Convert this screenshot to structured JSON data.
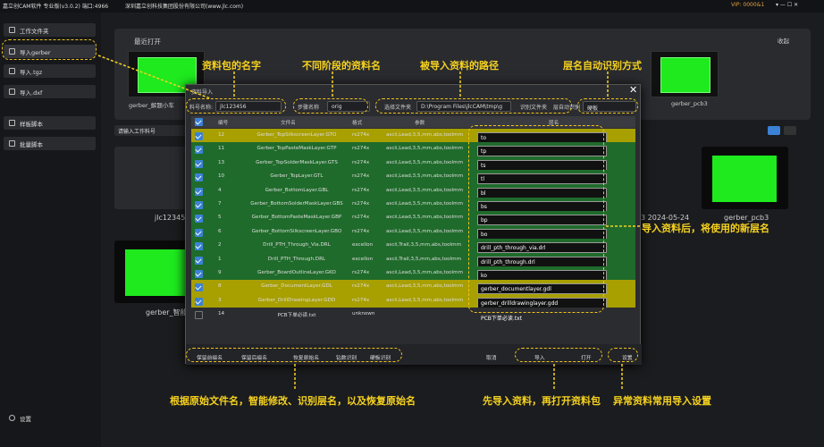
{
  "titlebar": {
    "app": "嘉立创CAM软件 专业版(v3.0.2) 端口:4966",
    "company": "深圳嘉立创科技集团股份有限公司(www.jlc.com)",
    "vip": "VIP: 0000&1",
    "controls": "▾  —  ☐  ✕"
  },
  "sidebar": {
    "items": [
      "工作文件夹",
      "导入gerber",
      "导入.tgz",
      "导入.dxf",
      "样板脚本",
      "批量脚本"
    ],
    "settings": "设置"
  },
  "recent": {
    "title": "最近打开",
    "collapse": "收起",
    "items": [
      "gerber_解题小车",
      "gerber_pcb3"
    ]
  },
  "workspace": {
    "search_placeholder": "请输入工作料号",
    "cards": [
      "jlc123456",
      "3  2024-05-24",
      "gerber_pcb3",
      "gerber_智能"
    ]
  },
  "dialog": {
    "title": "资料导入",
    "part_label": "料号名称:",
    "part_value": "jlc123456",
    "step_label": "步骤名称",
    "step_value": "orig",
    "folder_label": "选择文件夹",
    "folder_value": "D:\\Program Files\\jlcCAM\\tmp\\g",
    "folder_btn": "识别文件夹",
    "auto_label": "层自动识别",
    "auto_value": "硬板",
    "headers": [
      "编号",
      "文件名",
      "格式",
      "参数",
      "层名"
    ],
    "rows": [
      [
        "12",
        "Gerber_TopSilkscreenLayer.GTO",
        "rs274x",
        "ascii,Lead,3,5,mm,abs,toolmm",
        "to",
        true,
        "y"
      ],
      [
        "11",
        "Gerber_TopPasteMaskLayer.GTP",
        "rs274x",
        "ascii,Lead,3,5,mm,abs,toolmm",
        "tp",
        true,
        "g"
      ],
      [
        "13",
        "Gerber_TopSolderMaskLayer.GTS",
        "rs274x",
        "ascii,Lead,3,5,mm,abs,toolmm",
        "ts",
        true,
        "g"
      ],
      [
        "10",
        "Gerber_TopLayer.GTL",
        "rs274x",
        "ascii,Lead,3,5,mm,abs,toolmm",
        "tl",
        true,
        "g"
      ],
      [
        "4",
        "Gerber_BottomLayer.GBL",
        "rs274x",
        "ascii,Lead,3,5,mm,abs,toolmm",
        "bl",
        true,
        "g"
      ],
      [
        "7",
        "Gerber_BottomSolderMaskLayer.GBS",
        "rs274x",
        "ascii,Lead,3,5,mm,abs,toolmm",
        "bs",
        true,
        "g"
      ],
      [
        "5",
        "Gerber_BottomPasteMaskLayer.GBP",
        "rs274x",
        "ascii,Lead,3,5,mm,abs,toolmm",
        "bp",
        true,
        "g"
      ],
      [
        "6",
        "Gerber_BottomSilkscreenLayer.GBO",
        "rs274x",
        "ascii,Lead,3,5,mm,abs,toolmm",
        "bo",
        true,
        "g"
      ],
      [
        "2",
        "Drill_PTH_Through_Via.DRL",
        "excellon",
        "ascii,Trail,3,5,mm,abs,toolmm",
        "drill_pth_through_via.drl",
        true,
        "g"
      ],
      [
        "1",
        "Drill_PTH_Through.DRL",
        "excellon",
        "ascii,Trail,3,5,mm,abs,toolmm",
        "drill_pth_through.drl",
        true,
        "g"
      ],
      [
        "9",
        "Gerber_BoardOutlineLayer.GKO",
        "rs274x",
        "ascii,Lead,3,5,mm,abs,toolmm",
        "ko",
        true,
        "g"
      ],
      [
        "8",
        "Gerber_DocumentLayer.GDL",
        "rs274x",
        "ascii,Lead,3,5,mm,abs,toolmm",
        "gerber_documentlayer.gdl",
        true,
        "y"
      ],
      [
        "3",
        "Gerber_DrillDrawingLayer.GDD",
        "rs274x",
        "ascii,Lead,3,5,mm,abs,toolmm",
        "gerber_drilldrawinglayer.gdd",
        true,
        "y"
      ],
      [
        "14",
        "PCB下单必读.txt",
        "unknown",
        "",
        "PCB下单必读.txt",
        false,
        "d"
      ]
    ],
    "buttons": {
      "keep_before": "保留前缀名",
      "keep_after": "保留后缀名",
      "restore": "恢复原始名",
      "drill_id": "钻数识别",
      "param_id": "硬板识别",
      "cancel": "取消",
      "import": "导入",
      "open": "打开",
      "settings": "设置"
    }
  },
  "annotations": {
    "a1": "资料包的名字",
    "a2": "不同阶段的资料名",
    "a3": "被导入资料的路径",
    "a4": "层名自动识别方式",
    "a5": "导入资料后，将使用的新层名",
    "a6": "根据原始文件名，智能修改、识别层名，以及恢复原始名",
    "a7": "先导入资料，再打开资料包",
    "a8": "异常资料常用导入设置"
  },
  "colors": {
    "pcb_green": "#1eea1e",
    "highlight_yellow": "#b8b000",
    "annotation": "#f6d21f",
    "row_green": "#1f6b2b"
  }
}
